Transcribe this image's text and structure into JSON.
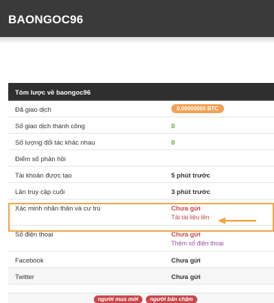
{
  "header": {
    "title": "BAONGOC96"
  },
  "panel": {
    "title": "Tóm lược về baongoc96"
  },
  "rows": [
    {
      "label": "Đã giao dịch",
      "value": "0.00000000 BTC"
    },
    {
      "label": "Số giao dịch thành công",
      "value": "0"
    },
    {
      "label": "Số lượng đối tác khác nhau",
      "value": "0"
    },
    {
      "label": "Điểm số phản hồi",
      "value": ""
    },
    {
      "label": "Tài khoản được tạo",
      "value": "5 phút trước"
    },
    {
      "label": "Lần truy cập cuối",
      "value": "3 phút trước"
    },
    {
      "label": "Xác minh nhân thân và cư trú",
      "value": "Chưa gửi",
      "link": "Tải tài liệu lên"
    },
    {
      "label": "Số điện thoại",
      "value": "Chưa gửi",
      "link": "Thêm số điện thoại"
    },
    {
      "label": "Facebook",
      "value": "Chưa gửi"
    },
    {
      "label": "Twitter",
      "value": "Chưa gửi"
    }
  ],
  "tags": [
    "người mua mới",
    "người bán chậm"
  ],
  "colors": {
    "highlight": "#f0a33e",
    "badge": "#f0a254",
    "accent_red": "#c9474c",
    "green": "#5aa432"
  }
}
